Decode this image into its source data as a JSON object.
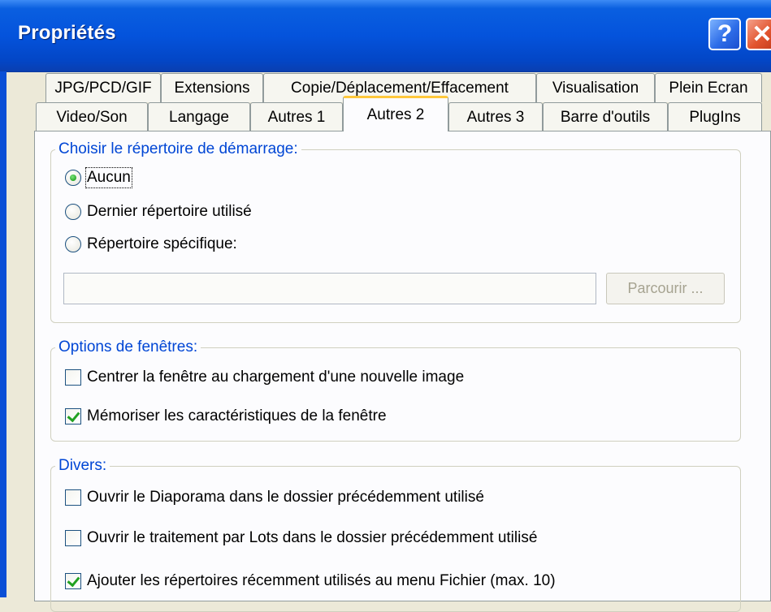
{
  "window": {
    "title": "Propriétés",
    "help_label": "?",
    "close_label": "✕"
  },
  "tabs_row1": [
    {
      "label": "JPG/PCD/GIF"
    },
    {
      "label": "Extensions"
    },
    {
      "label": "Copie/Déplacement/Effacement"
    },
    {
      "label": "Visualisation"
    },
    {
      "label": "Plein Ecran"
    }
  ],
  "tabs_row2": [
    {
      "label": "Video/Son"
    },
    {
      "label": "Langage"
    },
    {
      "label": "Autres 1"
    },
    {
      "label": "Autres 2",
      "active": true
    },
    {
      "label": "Autres 3"
    },
    {
      "label": "Barre d'outils"
    },
    {
      "label": "PlugIns"
    }
  ],
  "startup": {
    "title": "Choisir le répertoire de démarrage:",
    "options": [
      {
        "label": "Aucun",
        "selected": true
      },
      {
        "label": "Dernier répertoire utilisé",
        "selected": false
      },
      {
        "label": "Répertoire spécifique:",
        "selected": false
      }
    ],
    "path_value": "",
    "browse_label": "Parcourir ..."
  },
  "window_options": {
    "title": "Options de fenêtres:",
    "items": [
      {
        "label": "Centrer la fenêtre au chargement d'une nouvelle image",
        "checked": false
      },
      {
        "label": "Mémoriser les caractéristiques de la fenêtre",
        "checked": true
      }
    ]
  },
  "misc": {
    "title": "Divers:",
    "items": [
      {
        "label": "Ouvrir le  Diaporama dans le dossier précédemment utilisé",
        "checked": false
      },
      {
        "label": "Ouvrir le traitement par Lots dans le dossier précédemment utilisé",
        "checked": false
      },
      {
        "label": "Ajouter les répertoires récemment utilisés au menu Fichier (max. 10)",
        "checked": true
      }
    ]
  },
  "colors": {
    "titlebar": "#0453dc",
    "group_title": "#0046d5",
    "active_tab_accent": "#ffc83c",
    "check_mark": "#21a121"
  }
}
